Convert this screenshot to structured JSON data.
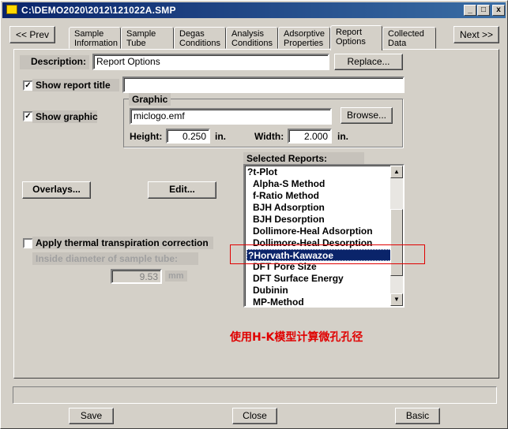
{
  "window": {
    "title": "C:\\DEMO2020\\2012\\121022A.SMP",
    "minimize": "_",
    "maximize": "□",
    "close": "x"
  },
  "nav": {
    "prev": "<< Prev",
    "next": "Next >>"
  },
  "tabs": [
    {
      "label": "Sample Information"
    },
    {
      "label": "Sample Tube"
    },
    {
      "label": "Degas Conditions"
    },
    {
      "label": "Analysis Conditions"
    },
    {
      "label": "Adsorptive Properties"
    },
    {
      "label": "Report Options",
      "active": true
    },
    {
      "label": "Collected Data"
    }
  ],
  "description": {
    "label": "Description:",
    "value": "Report Options",
    "replace_button": "Replace..."
  },
  "report_title": {
    "label": "Show report title",
    "checked": true,
    "value": ""
  },
  "show_graphic": {
    "label": "Show graphic",
    "checked": true
  },
  "graphic": {
    "group_label": "Graphic",
    "file": "miclogo.emf",
    "browse_button": "Browse...",
    "height_label": "Height:",
    "height_value": "0.250",
    "height_unit": "in.",
    "width_label": "Width:",
    "width_value": "2.000",
    "width_unit": "in."
  },
  "overlays_button": "Overlays...",
  "edit_button": "Edit...",
  "thermal": {
    "label": "Apply thermal transpiration correction",
    "checked": false,
    "diameter_label": "Inside diameter of sample tube:",
    "diameter_value": "9.53",
    "diameter_unit": "mm"
  },
  "selected_reports": {
    "label": "Selected Reports:",
    "items": [
      "?t-Plot",
      "Alpha-S Method",
      "f-Ratio Method",
      "BJH Adsorption",
      "BJH Desorption",
      "Dollimore-Heal Adsorption",
      "Dollimore-Heal Desorption",
      "?Horvath-Kawazoe",
      "DFT Pore Size",
      "DFT Surface Energy",
      "Dubinin",
      "MP-Method"
    ],
    "selected_index": 7
  },
  "annotation": "使用H-K模型计算微孔孔径",
  "colors": {
    "annotation": "#e00000",
    "selection": "#0a246a",
    "titlebar": "#0a246a"
  },
  "bottom": {
    "save": "Save",
    "close": "Close",
    "basic": "Basic"
  }
}
